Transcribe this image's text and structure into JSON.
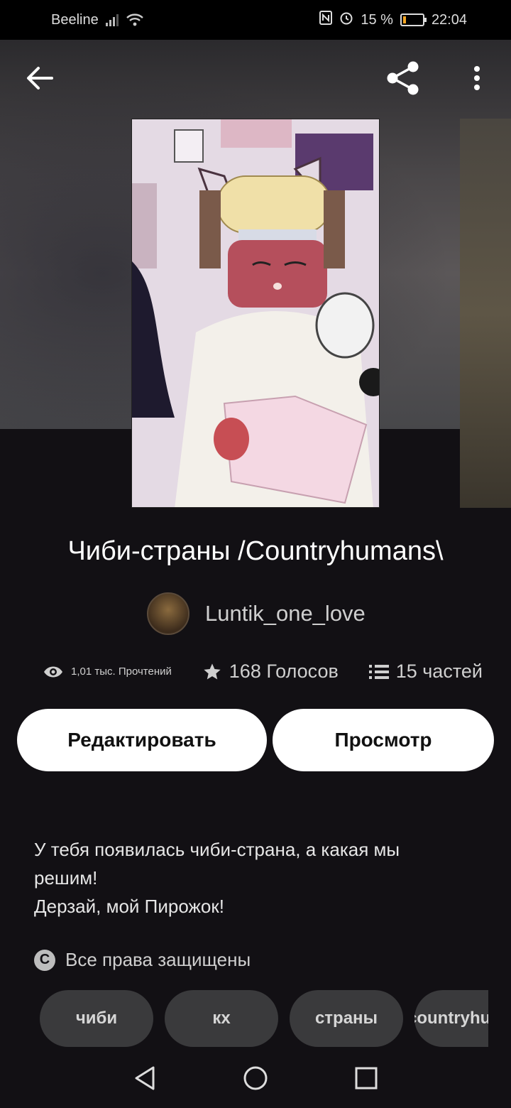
{
  "status_bar": {
    "carrier": "Beeline",
    "battery_percent": "15 %",
    "time": "22:04",
    "battery_level": 0.15,
    "icons": [
      "signal-icon",
      "wifi-icon",
      "nfc-icon",
      "alarm-icon",
      "battery-icon"
    ]
  },
  "toolbar": {
    "back_icon": "arrow-left-icon",
    "share_icon": "share-icon",
    "more_icon": "more-vertical-icon"
  },
  "story": {
    "title": "Чиби-страны /Countryhumans\\",
    "author": "Luntik_one_love",
    "stats": {
      "reads": "1,01 тыс. Прочтений",
      "votes": "168 Голосов",
      "parts": "15 частей"
    },
    "description_lines": [
      "У тебя появилась чиби-страна, а какая мы",
      "решим!",
      "Дерзай, мой Пирожок!"
    ],
    "rights": "Все права защищены"
  },
  "actions": {
    "edit_label": "Редактировать",
    "view_label": "Просмотр"
  },
  "tags": [
    "чиби",
    "кх",
    "страны",
    "countryhumans"
  ],
  "colors": {
    "background": "#121014",
    "button_bg": "#ffffff",
    "tag_bg": "#3a3a3c"
  }
}
